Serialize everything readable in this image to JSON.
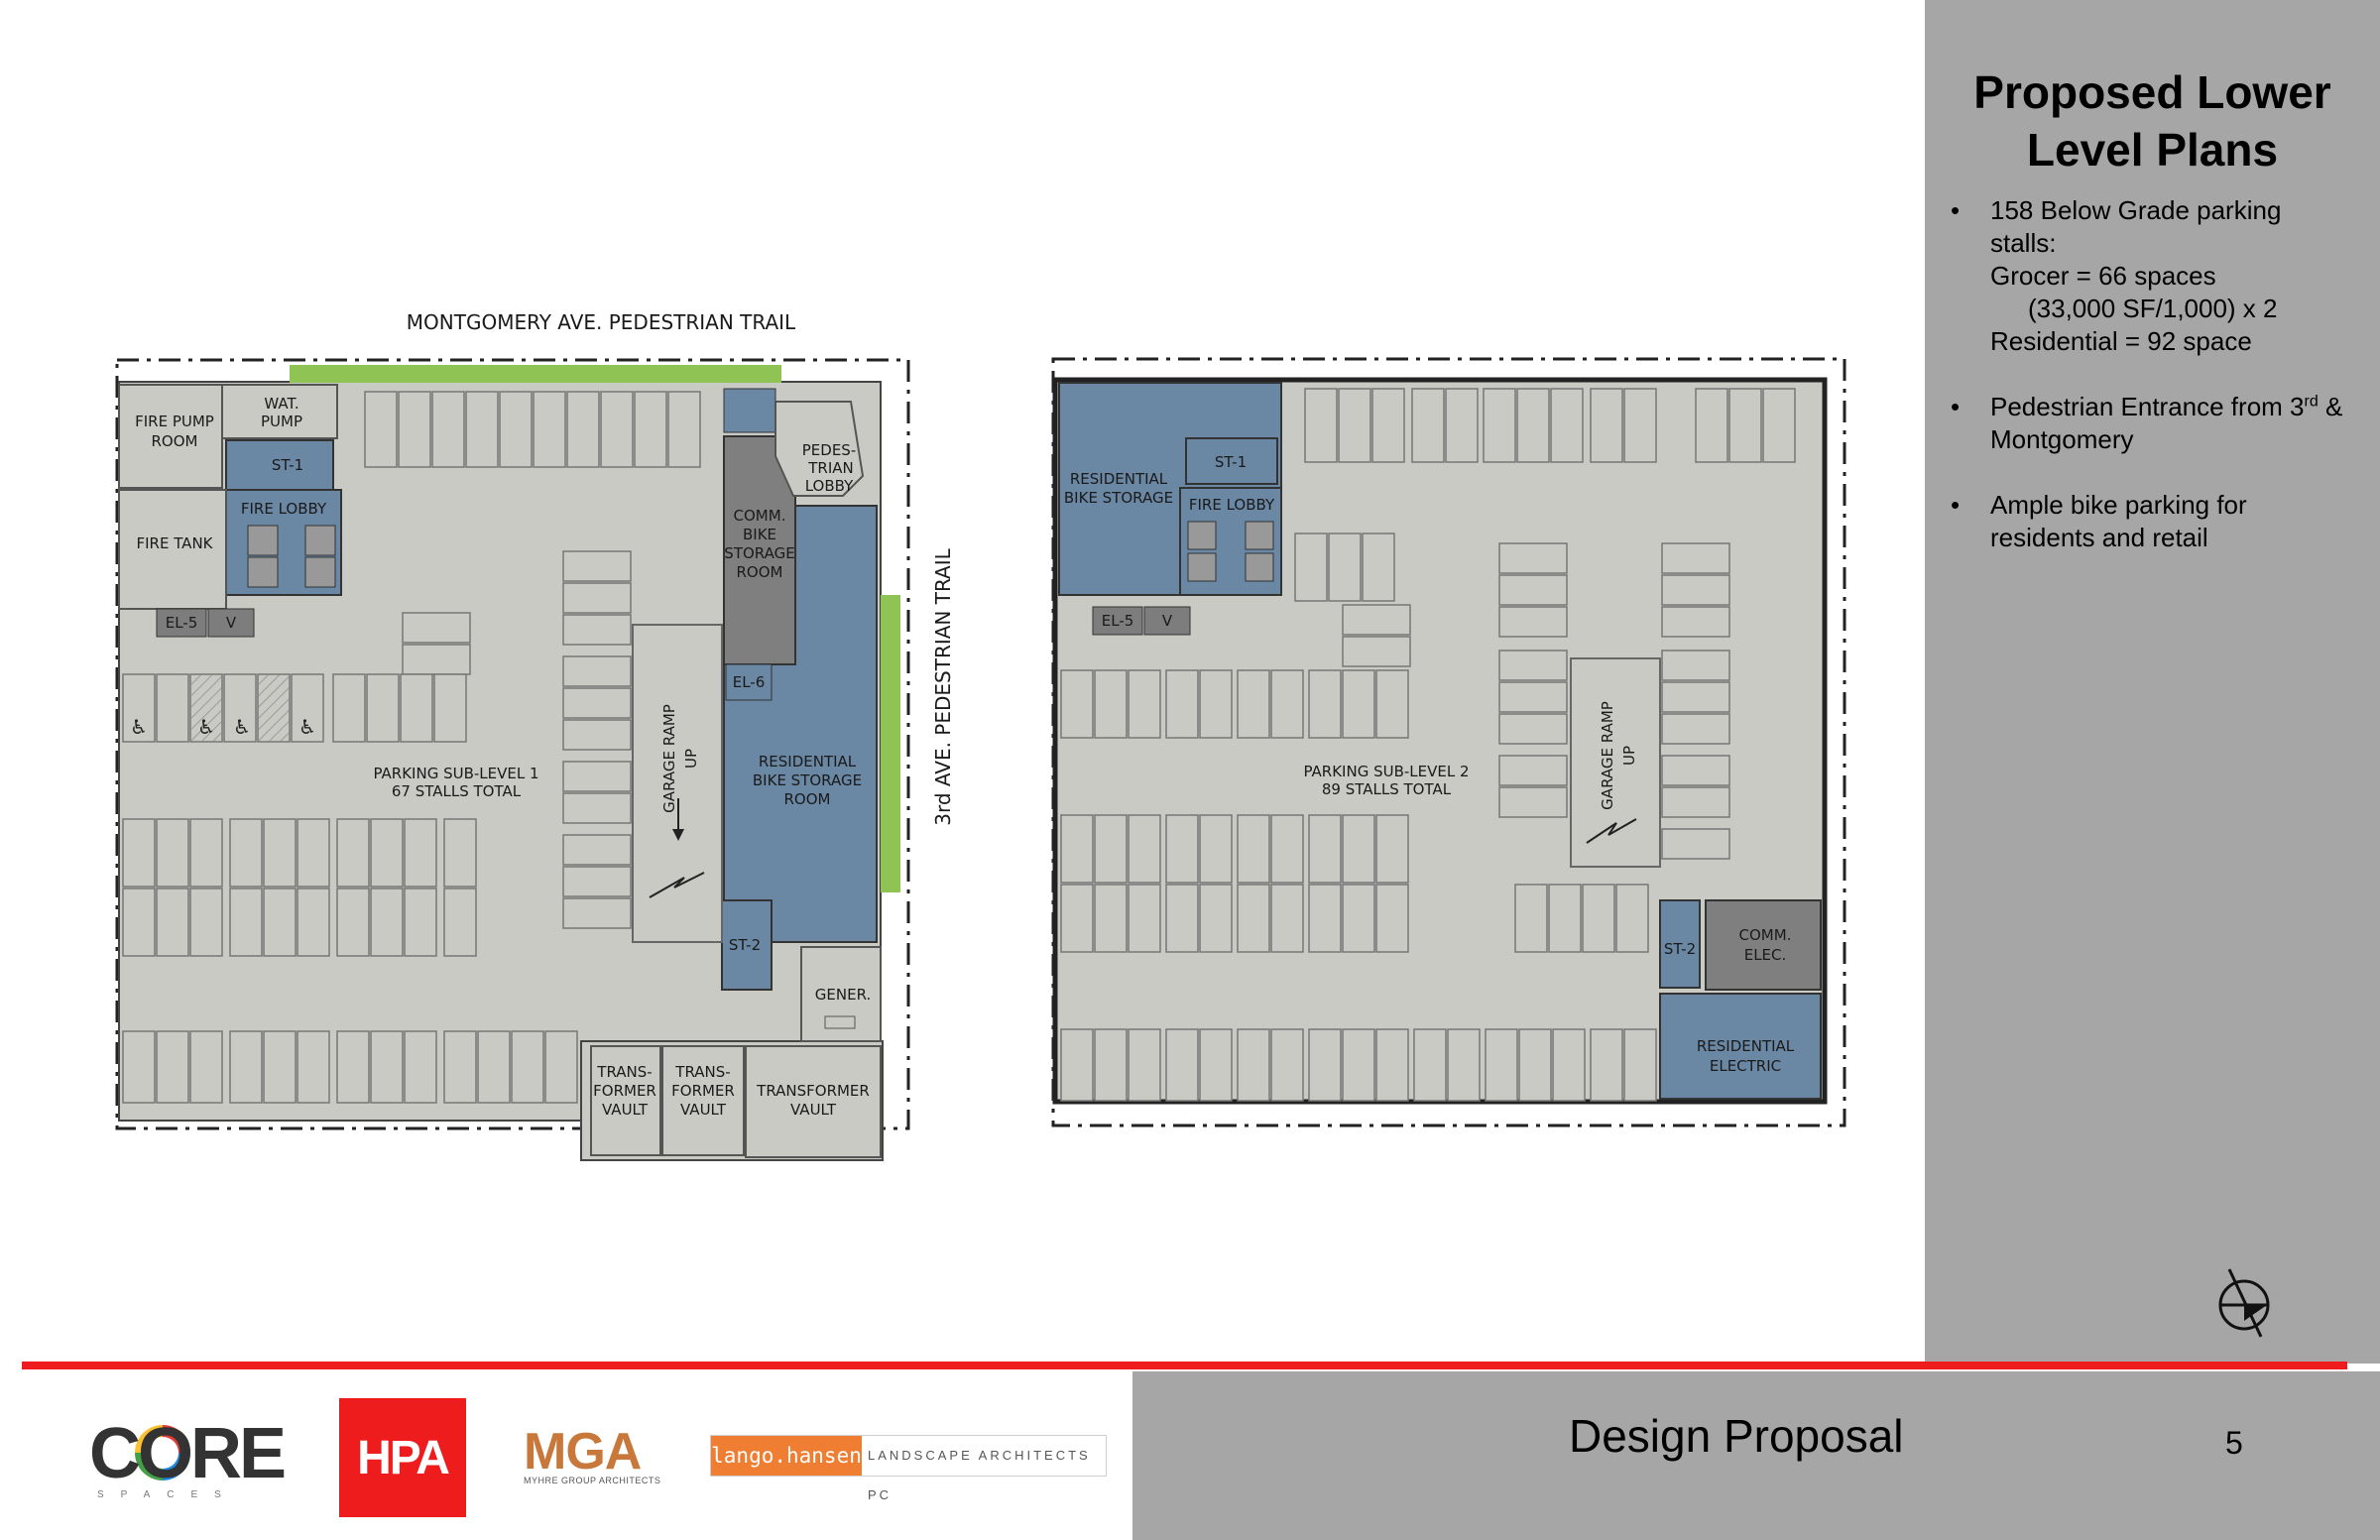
{
  "panel": {
    "title_line1": "Proposed Lower",
    "title_line2": "Level Plans",
    "bullets": {
      "b1_l1": "158 Below Grade parking",
      "b1_l2": "stalls:",
      "b1_l3": "Grocer = 66 spaces",
      "b1_l4": "(33,000 SF/1,000) x 2",
      "b1_l5": "Residential = 92 space",
      "b2_pre": "Pedestrian Entrance from 3",
      "b2_sup": "rd",
      "b2_post": " &",
      "b2_l2": "Montgomery",
      "b3_l1": "Ample bike parking for",
      "b3_l2": "residents and retail"
    }
  },
  "footer": {
    "title": "Design Proposal",
    "page_number": "5"
  },
  "logos": {
    "core": "CORE",
    "core_tag": "SPACES",
    "hpa": "HPA",
    "mga": "MGA",
    "mga_sub": "MYHRE GROUP ARCHITECTS",
    "lango_box": "lango.hansen",
    "lango_text": "LANDSCAPE ARCHITECTS PC"
  },
  "plan1": {
    "street_top": "MONTGOMERY AVE. PEDESTRIAN TRAIL",
    "street_right": "3rd AVE. PEDESTRIAN TRAIL",
    "fire_pump_room_1": "FIRE PUMP",
    "fire_pump_room_2": "ROOM",
    "wat_pump_1": "WAT.",
    "wat_pump_2": "PUMP",
    "st1": "ST-1",
    "fire_lobby": "FIRE LOBBY",
    "fire_tank": "FIRE TANK",
    "el5": "EL-5",
    "v": "V",
    "el6": "EL-6",
    "st2": "ST-2",
    "pedestrian_lobby_1": "PEDES-",
    "pedestrian_lobby_2": "TRIAN",
    "pedestrian_lobby_3": "LOBBY",
    "comm_bike_1": "COMM.",
    "comm_bike_2": "BIKE",
    "comm_bike_3": "STORAGE",
    "comm_bike_4": "ROOM",
    "res_bike_1": "RESIDENTIAL",
    "res_bike_2": "BIKE STORAGE",
    "res_bike_3": "ROOM",
    "level_1": "PARKING SUB-LEVEL 1",
    "level_2": "67 STALLS TOTAL",
    "ramp_1": "GARAGE RAMP",
    "ramp_2": "UP",
    "gener": "GENER.",
    "trans_1a": "TRANS-",
    "trans_1b": "FORMER",
    "trans_1c": "VAULT",
    "trans_2a": "TRANS-",
    "trans_2b": "FORMER",
    "trans_2c": "VAULT",
    "trans_3a": "TRANSFORMER",
    "trans_3b": "VAULT"
  },
  "plan2": {
    "res_bike_1": "RESIDENTIAL",
    "res_bike_2": "BIKE STORAGE",
    "st1": "ST-1",
    "fire_lobby": "FIRE LOBBY",
    "el5": "EL-5",
    "v": "V",
    "level_1": "PARKING SUB-LEVEL 2",
    "level_2": "89 STALLS TOTAL",
    "ramp_1": "GARAGE RAMP",
    "ramp_2": "UP",
    "st2": "ST-2",
    "comm_elec_1": "COMM.",
    "comm_elec_2": "ELEC.",
    "res_elec_1": "RESIDENTIAL",
    "res_elec_2": "ELECTRIC"
  },
  "colors": {
    "panel_gray": "#a6a6a6",
    "accent_red": "#ee1c1c",
    "plan_blue": "#6a87a3",
    "plan_floor": "#c9cac4",
    "plan_green": "#8fc454"
  },
  "icons": {
    "north_arrow": "north-arrow-icon",
    "accessible": "wheelchair-icon"
  }
}
